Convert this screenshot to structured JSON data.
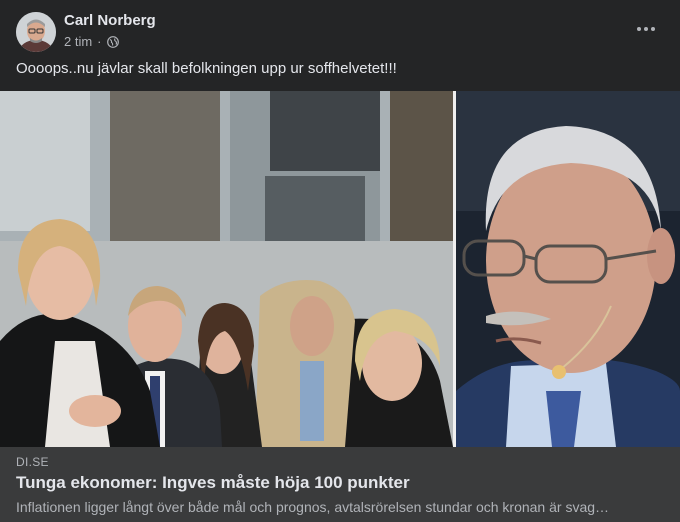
{
  "post": {
    "author": "Carl Norberg",
    "time": "2 tim",
    "separator": "·",
    "privacy_icon": "globe-icon",
    "text": "Oooops..nu jävlar skall befolkningen upp ur soffhelvetet!!!",
    "more_icon": "more-options-icon"
  },
  "link_preview": {
    "domain": "DI.SE",
    "title": "Tunga ekonomer: Ingves måste höja 100 punkter",
    "description": "Inflationen ligger långt över både mål och prognos, avtalsrörelsen stundar och kronan är svag…"
  },
  "colors": {
    "background": "#242526",
    "link_box": "#3a3b3c",
    "primary_text": "#e4e6eb",
    "secondary_text": "#b0b3b8"
  }
}
